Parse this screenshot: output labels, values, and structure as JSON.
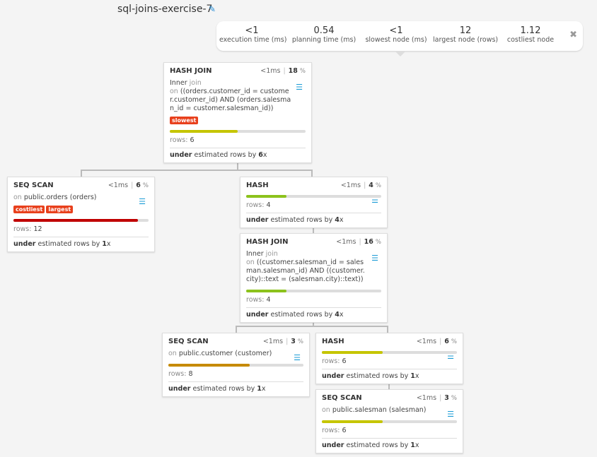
{
  "header": {
    "title": "sql-joins-exercise-7",
    "edit_icon": "pencil-icon"
  },
  "stats": [
    {
      "value": "<1",
      "label": "execution time (ms)"
    },
    {
      "value": "0.54",
      "label": "planning time (ms)"
    },
    {
      "value": "<1",
      "label": "slowest node (ms)"
    },
    {
      "value": "12",
      "label": "largest node (rows)"
    },
    {
      "value": "1.12",
      "label": "costliest node"
    }
  ],
  "close_icon": "close-icon",
  "nodes": [
    {
      "name": "HASH JOIN",
      "time": "<1ms",
      "percent": "18",
      "join_type": "Inner",
      "join_kw": "join",
      "on_kw": "on",
      "condition": "((orders.customer_id = customer.customer_id) AND (orders.salesman_id = customer.salesman_id))",
      "badges": [
        "slowest"
      ],
      "bar_fraction": 0.5,
      "bar_color": "#c5c500",
      "rows_label": "rows:",
      "rows": "6",
      "est_dir": "under",
      "est_text": "estimated rows by",
      "est_factor": "6",
      "est_suffix": "x"
    },
    {
      "name": "SEQ SCAN",
      "time": "<1ms",
      "percent": "6",
      "on_kw": "on",
      "relation": "public.orders (orders)",
      "badges": [
        "costliest",
        "largest"
      ],
      "bar_fraction": 0.92,
      "bar_color": "#c00000",
      "rows_label": "rows:",
      "rows": "12",
      "est_dir": "under",
      "est_text": "estimated rows by",
      "est_factor": "1",
      "est_suffix": "x"
    },
    {
      "name": "HASH",
      "time": "<1ms",
      "percent": "4",
      "badges": [],
      "bar_fraction": 0.3,
      "bar_color": "#8cc21c",
      "rows_label": "rows:",
      "rows": "4",
      "est_dir": "under",
      "est_text": "estimated rows by",
      "est_factor": "4",
      "est_suffix": "x"
    },
    {
      "name": "HASH JOIN",
      "time": "<1ms",
      "percent": "16",
      "join_type": "Inner",
      "join_kw": "join",
      "on_kw": "on",
      "condition": "((customer.salesman_id = salesman.salesman_id) AND ((customer.city)::text = (salesman.city)::text))",
      "badges": [],
      "bar_fraction": 0.3,
      "bar_color": "#8cc21c",
      "rows_label": "rows:",
      "rows": "4",
      "est_dir": "under",
      "est_text": "estimated rows by",
      "est_factor": "4",
      "est_suffix": "x"
    },
    {
      "name": "SEQ SCAN",
      "time": "<1ms",
      "percent": "3",
      "on_kw": "on",
      "relation": "public.customer (customer)",
      "badges": [],
      "bar_fraction": 0.6,
      "bar_color": "#c68a00",
      "rows_label": "rows:",
      "rows": "8",
      "est_dir": "under",
      "est_text": "estimated rows by",
      "est_factor": "1",
      "est_suffix": "x"
    },
    {
      "name": "HASH",
      "time": "<1ms",
      "percent": "6",
      "badges": [],
      "bar_fraction": 0.45,
      "bar_color": "#c5c500",
      "rows_label": "rows:",
      "rows": "6",
      "est_dir": "under",
      "est_text": "estimated rows by",
      "est_factor": "1",
      "est_suffix": "x"
    },
    {
      "name": "SEQ SCAN",
      "time": "<1ms",
      "percent": "3",
      "on_kw": "on",
      "relation": "public.salesman (salesman)",
      "badges": [],
      "bar_fraction": 0.45,
      "bar_color": "#c5c500",
      "rows_label": "rows:",
      "rows": "6",
      "est_dir": "under",
      "est_text": "estimated rows by",
      "est_factor": "1",
      "est_suffix": "x"
    }
  ]
}
